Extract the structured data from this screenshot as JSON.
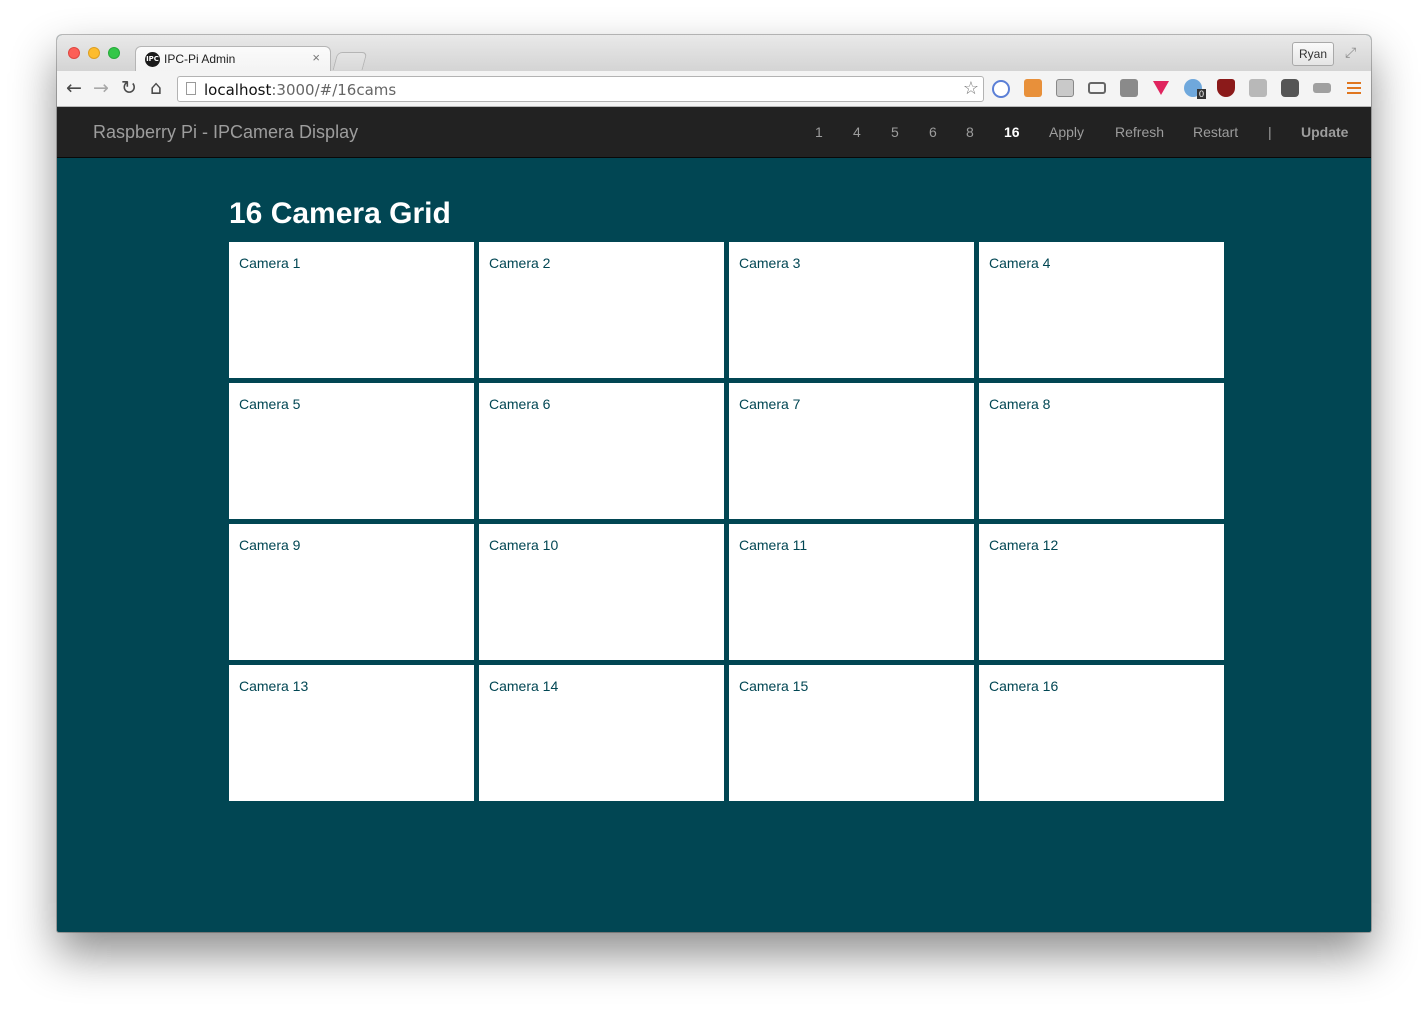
{
  "browser": {
    "tab_title": "IPC-Pi Admin",
    "tab_close": "×",
    "favicon_text": "IPC",
    "user": "Ryan",
    "url_host": "localhost",
    "url_rest": ":3000/#/16cams",
    "icons": [
      "back-icon",
      "forward-icon",
      "reload-icon",
      "home-icon",
      "bookmark-star-icon",
      "fullscreen-icon"
    ],
    "extension_badge": "0"
  },
  "navbar": {
    "brand": "Raspberry Pi - IPCamera Display",
    "links": [
      "1",
      "4",
      "5",
      "6",
      "8",
      "16",
      "Apply",
      "Refresh",
      "Restart"
    ],
    "active": "16",
    "separator": "|",
    "update": "Update"
  },
  "page": {
    "title": "16 Camera Grid",
    "cameras": [
      "Camera 1",
      "Camera 2",
      "Camera 3",
      "Camera 4",
      "Camera 5",
      "Camera 6",
      "Camera 7",
      "Camera 8",
      "Camera 9",
      "Camera 10",
      "Camera 11",
      "Camera 12",
      "Camera 13",
      "Camera 14",
      "Camera 15",
      "Camera 16"
    ]
  },
  "colors": {
    "page_background": "#014653",
    "navbar_background": "#222222",
    "tile_background": "#ffffff"
  }
}
